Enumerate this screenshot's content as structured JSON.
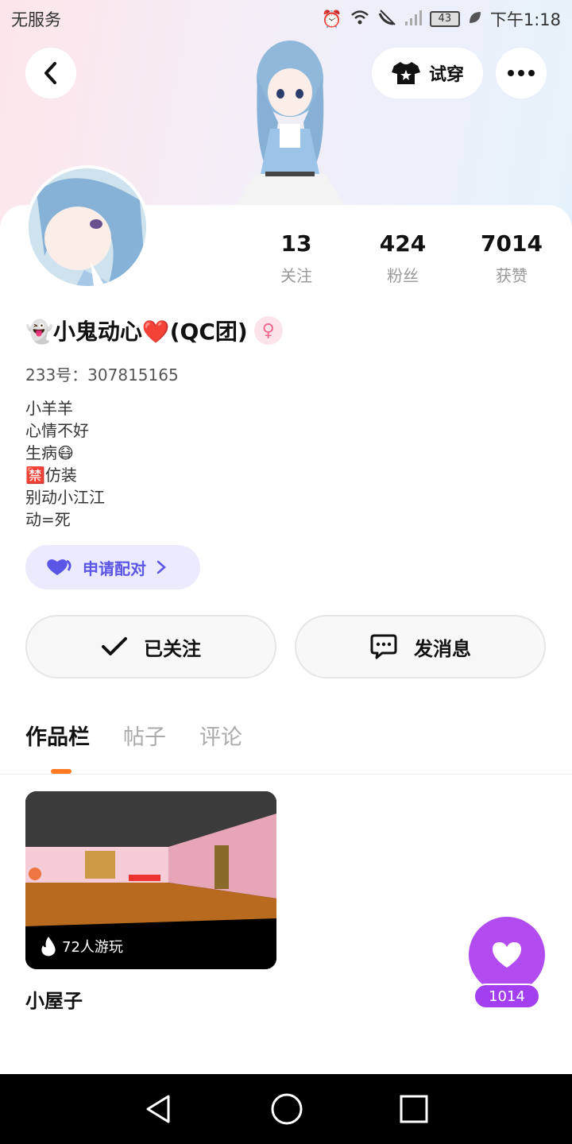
{
  "status_bar": {
    "carrier": "无服务",
    "battery": "43",
    "time": "下午1:18"
  },
  "header": {
    "try_on_label": "试穿"
  },
  "profile": {
    "stats": [
      {
        "value": "13",
        "label": "关注"
      },
      {
        "value": "424",
        "label": "粉丝"
      },
      {
        "value": "7014",
        "label": "获赞"
      }
    ],
    "name": "👻小鬼动心❤️(QC团)",
    "gender_symbol": "♀",
    "id_line": "233号：307815165",
    "bio_lines": [
      "小羊羊",
      "心情不好",
      "生病😷",
      "🈲仿装",
      "别动小江江",
      "动=死"
    ],
    "pair_label": "申请配对"
  },
  "actions": {
    "follow_label": "已关注",
    "message_label": "发消息"
  },
  "tabs": [
    {
      "label": "作品栏",
      "active": true
    },
    {
      "label": "帖子",
      "active": false
    },
    {
      "label": "评论",
      "active": false
    }
  ],
  "works": [
    {
      "title": "小屋子",
      "plays": "72人游玩"
    }
  ],
  "like": {
    "count": "1014"
  },
  "colors": {
    "accent_purple": "#b24bf0",
    "tab_indicator": "#ff7a21",
    "pair_text": "#5b56e6"
  }
}
